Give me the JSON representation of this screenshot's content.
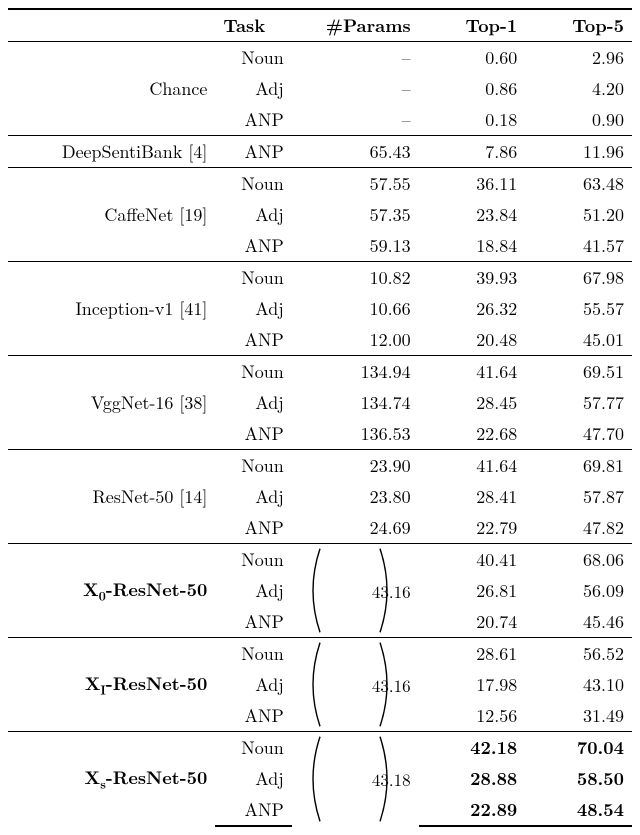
{
  "chart_data": {
    "type": "table",
    "headers": {
      "model": "",
      "task": "Task",
      "params": "#Params",
      "top1": "Top-1",
      "top5": "Top-5"
    },
    "groups": [
      {
        "model": "Chance",
        "rows": [
          {
            "task": "Noun",
            "params": "–",
            "top1": "0.60",
            "top5": "2.96"
          },
          {
            "task": "Adj",
            "params": "–",
            "top1": "0.86",
            "top5": "4.20"
          },
          {
            "task": "ANP",
            "params": "–",
            "top1": "0.18",
            "top5": "0.90"
          }
        ]
      },
      {
        "model": "DeepSentiBank [4]",
        "rows": [
          {
            "task": "ANP",
            "params": "65.43",
            "top1": "7.86",
            "top5": "11.96"
          }
        ]
      },
      {
        "model": "CaffeNet [19]",
        "rows": [
          {
            "task": "Noun",
            "params": "57.55",
            "top1": "36.11",
            "top5": "63.48"
          },
          {
            "task": "Adj",
            "params": "57.35",
            "top1": "23.84",
            "top5": "51.20"
          },
          {
            "task": "ANP",
            "params": "59.13",
            "top1": "18.84",
            "top5": "41.57"
          }
        ]
      },
      {
        "model": "Inception-v1 [41]",
        "rows": [
          {
            "task": "Noun",
            "params": "10.82",
            "top1": "39.93",
            "top5": "67.98"
          },
          {
            "task": "Adj",
            "params": "10.66",
            "top1": "26.32",
            "top5": "55.57"
          },
          {
            "task": "ANP",
            "params": "12.00",
            "top1": "20.48",
            "top5": "45.01"
          }
        ]
      },
      {
        "model": "VggNet-16 [38]",
        "rows": [
          {
            "task": "Noun",
            "params": "134.94",
            "top1": "41.64",
            "top5": "69.51"
          },
          {
            "task": "Adj",
            "params": "134.74",
            "top1": "28.45",
            "top5": "57.77"
          },
          {
            "task": "ANP",
            "params": "136.53",
            "top1": "22.68",
            "top5": "47.70"
          }
        ]
      },
      {
        "model": "ResNet-50 [14]",
        "rows": [
          {
            "task": "Noun",
            "params": "23.90",
            "top1": "41.64",
            "top5": "69.81"
          },
          {
            "task": "Adj",
            "params": "23.80",
            "top1": "28.41",
            "top5": "57.87"
          },
          {
            "task": "ANP",
            "params": "24.69",
            "top1": "22.79",
            "top5": "47.82"
          }
        ]
      },
      {
        "model_html": "X<sub>0</sub>-ResNet-50",
        "bold_model": true,
        "bracket_params": "43.16",
        "rows": [
          {
            "task": "Noun",
            "top1": "40.41",
            "top5": "68.06"
          },
          {
            "task": "Adj",
            "top1": "26.81",
            "top5": "56.09"
          },
          {
            "task": "ANP",
            "top1": "20.74",
            "top5": "45.46"
          }
        ]
      },
      {
        "model_html": "X<sub>I</sub>-ResNet-50",
        "bold_model": true,
        "bracket_params": "43.16",
        "rows": [
          {
            "task": "Noun",
            "top1": "28.61",
            "top5": "56.52"
          },
          {
            "task": "Adj",
            "top1": "17.98",
            "top5": "43.10"
          },
          {
            "task": "ANP",
            "top1": "12.56",
            "top5": "31.49"
          }
        ]
      },
      {
        "model_html": "X<sub>s</sub>-ResNet-50",
        "bold_model": true,
        "bracket_params": "43.18",
        "bold_rows": true,
        "rows": [
          {
            "task": "Noun",
            "top1": "42.18",
            "top5": "70.04"
          },
          {
            "task": "Adj",
            "top1": "28.88",
            "top5": "58.50"
          },
          {
            "task": "ANP",
            "top1": "22.89",
            "top5": "48.54"
          }
        ]
      }
    ]
  },
  "caption_fragment": ""
}
